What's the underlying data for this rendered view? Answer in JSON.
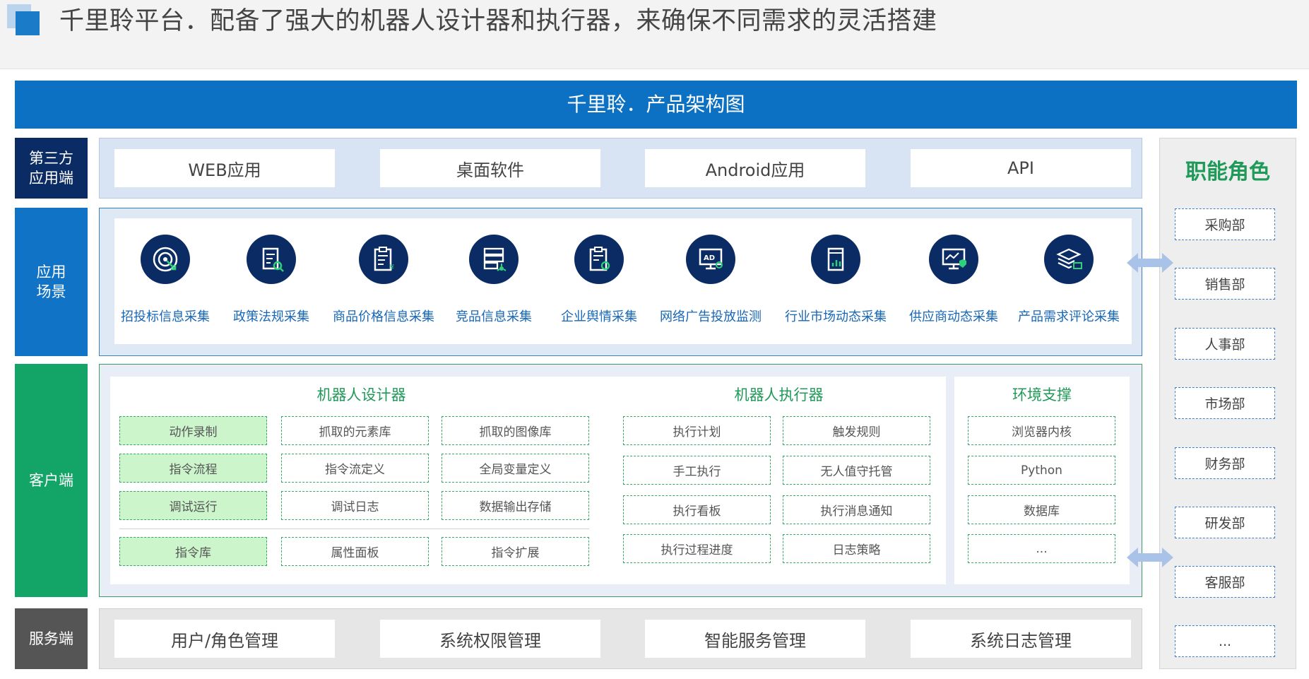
{
  "header": {
    "title": "千里聆平台．配备了强大的机器人设计器和执行器，来确保不同需求的灵活搭建"
  },
  "banner": {
    "title": "千里聆．产品架构图"
  },
  "layers": {
    "third_party": {
      "label_line1": "第三方",
      "label_line2": "应用端",
      "items": [
        "WEB应用",
        "桌面软件",
        "Android应用",
        "API"
      ]
    },
    "scenarios": {
      "label_line1": "应用",
      "label_line2": "场景",
      "items": [
        {
          "label": "招投标信息采集",
          "icon": "target-click-icon"
        },
        {
          "label": "政策法规采集",
          "icon": "document-search-icon"
        },
        {
          "label": "商品价格信息采集",
          "icon": "price-clipboard-icon"
        },
        {
          "label": "竞品信息采集",
          "icon": "server-network-icon"
        },
        {
          "label": "企业舆情采集",
          "icon": "clipboard-chart-icon"
        },
        {
          "label": "网络广告投放监测",
          "icon": "ad-monitor-icon"
        },
        {
          "label": "行业市场动态采集",
          "icon": "market-chart-icon"
        },
        {
          "label": "供应商动态采集",
          "icon": "monitor-shield-icon"
        },
        {
          "label": "产品需求评论采集",
          "icon": "layers-comment-icon"
        }
      ]
    },
    "client": {
      "label": "客户端",
      "designer": {
        "title": "机器人设计器",
        "rows": [
          [
            "动作录制",
            "抓取的元素库",
            "抓取的图像库"
          ],
          [
            "指令流程",
            "指令流定义",
            "全局变量定义"
          ],
          [
            "调试运行",
            "调试日志",
            "数据输出存储"
          ],
          [
            "指令库",
            "属性面板",
            "指令扩展"
          ]
        ]
      },
      "executor": {
        "title": "机器人执行器",
        "rows": [
          [
            "执行计划",
            "触发规则"
          ],
          [
            "手工执行",
            "无人值守托管"
          ],
          [
            "执行看板",
            "执行消息通知"
          ],
          [
            "执行过程进度",
            "日志策略"
          ]
        ]
      },
      "environment": {
        "title": "环境支撑",
        "items": [
          "浏览器内核",
          "Python",
          "数据库",
          "..."
        ]
      }
    },
    "server": {
      "label": "服务端",
      "items": [
        "用户/角色管理",
        "系统权限管理",
        "智能服务管理",
        "系统日志管理"
      ]
    }
  },
  "roles": {
    "title": "职能角色",
    "items": [
      "采购部",
      "销售部",
      "人事部",
      "市场部",
      "财务部",
      "研发部",
      "客服部",
      "..."
    ]
  },
  "colors": {
    "banner": "#0c71c3",
    "third_party_label": "#0b2b65",
    "scenario_label": "#1173c5",
    "client_label": "#12a567",
    "server_label": "#555555",
    "roles_title": "#1f9a58",
    "icon_circle": "#0b2b65"
  }
}
